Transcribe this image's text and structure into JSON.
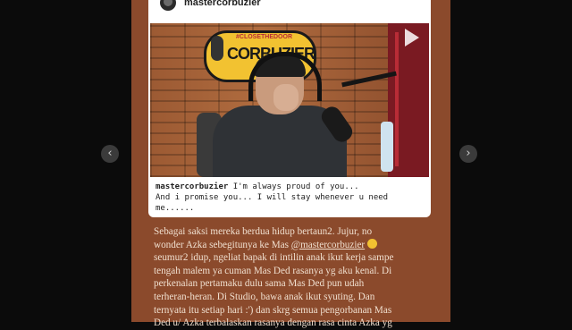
{
  "post": {
    "username": "mastercorbuzier",
    "caption_user": "mastercorbuzier",
    "caption_line1": "I'm always proud of you...",
    "caption_line2": "And i promise you... I will stay whenever u need me......",
    "video_logo_tag": "#CLOSETHEDOOR",
    "video_logo_text": "CORBUZIER",
    "icon": "play-icon"
  },
  "text": {
    "line1": "Sebagai saksi mereka berdua hidup bertaun2. Jujur, no",
    "line2_a": "wonder Azka sebegitunya ke Mas ",
    "mention": "@mastercorbuzier",
    "line3": "seumur2 idup, ngeliat bapak di intilin anak ikut kerja sampe",
    "line4": "tengah malem ya cuman Mas Ded rasanya yg aku kenal. Di",
    "line5": "perkenalan pertamaku dulu sama Mas Ded pun udah",
    "line6": "terheran-heran. Di Studio, bawa anak ikut syuting. Dan",
    "line7": "ternyata itu setiap hari :') dan skrg semua pengorbanan Mas",
    "line8": "Ded u/ Azka terbalaskan rasanya dengan rasa cinta Azka yg"
  },
  "nav": {
    "prev": "‹",
    "next": "›"
  },
  "colors": {
    "background": "#0b0b0b",
    "slide": "#8b4a2c",
    "text": "#f0dfcf"
  }
}
